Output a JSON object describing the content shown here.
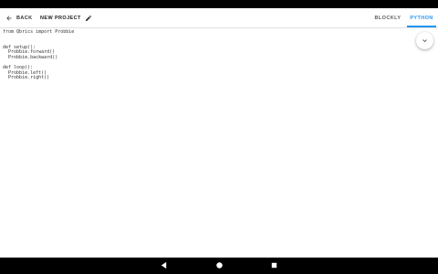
{
  "app_bar": {
    "back_label": "BACK",
    "project_title": "NEW PROJECT"
  },
  "tabs": [
    {
      "label": "BLOCKLY",
      "selected": false
    },
    {
      "label": "PYTHON",
      "selected": true
    }
  ],
  "accent_color": "#2196f3",
  "code": {
    "lines": [
      "from Qbrics import Probbie",
      "",
      "",
      "def setup():",
      "  Probbie.forward()",
      "  Probbie.backward()",
      "",
      "def loop():",
      "  Probbie.left()",
      "  Probbie.right()"
    ]
  },
  "icons": {
    "back": "arrow-back-icon",
    "edit": "pencil-icon",
    "fab": "chevron-down-icon",
    "nav_back": "triangle-back-icon",
    "nav_home": "circle-home-icon",
    "nav_recents": "square-recents-icon"
  }
}
